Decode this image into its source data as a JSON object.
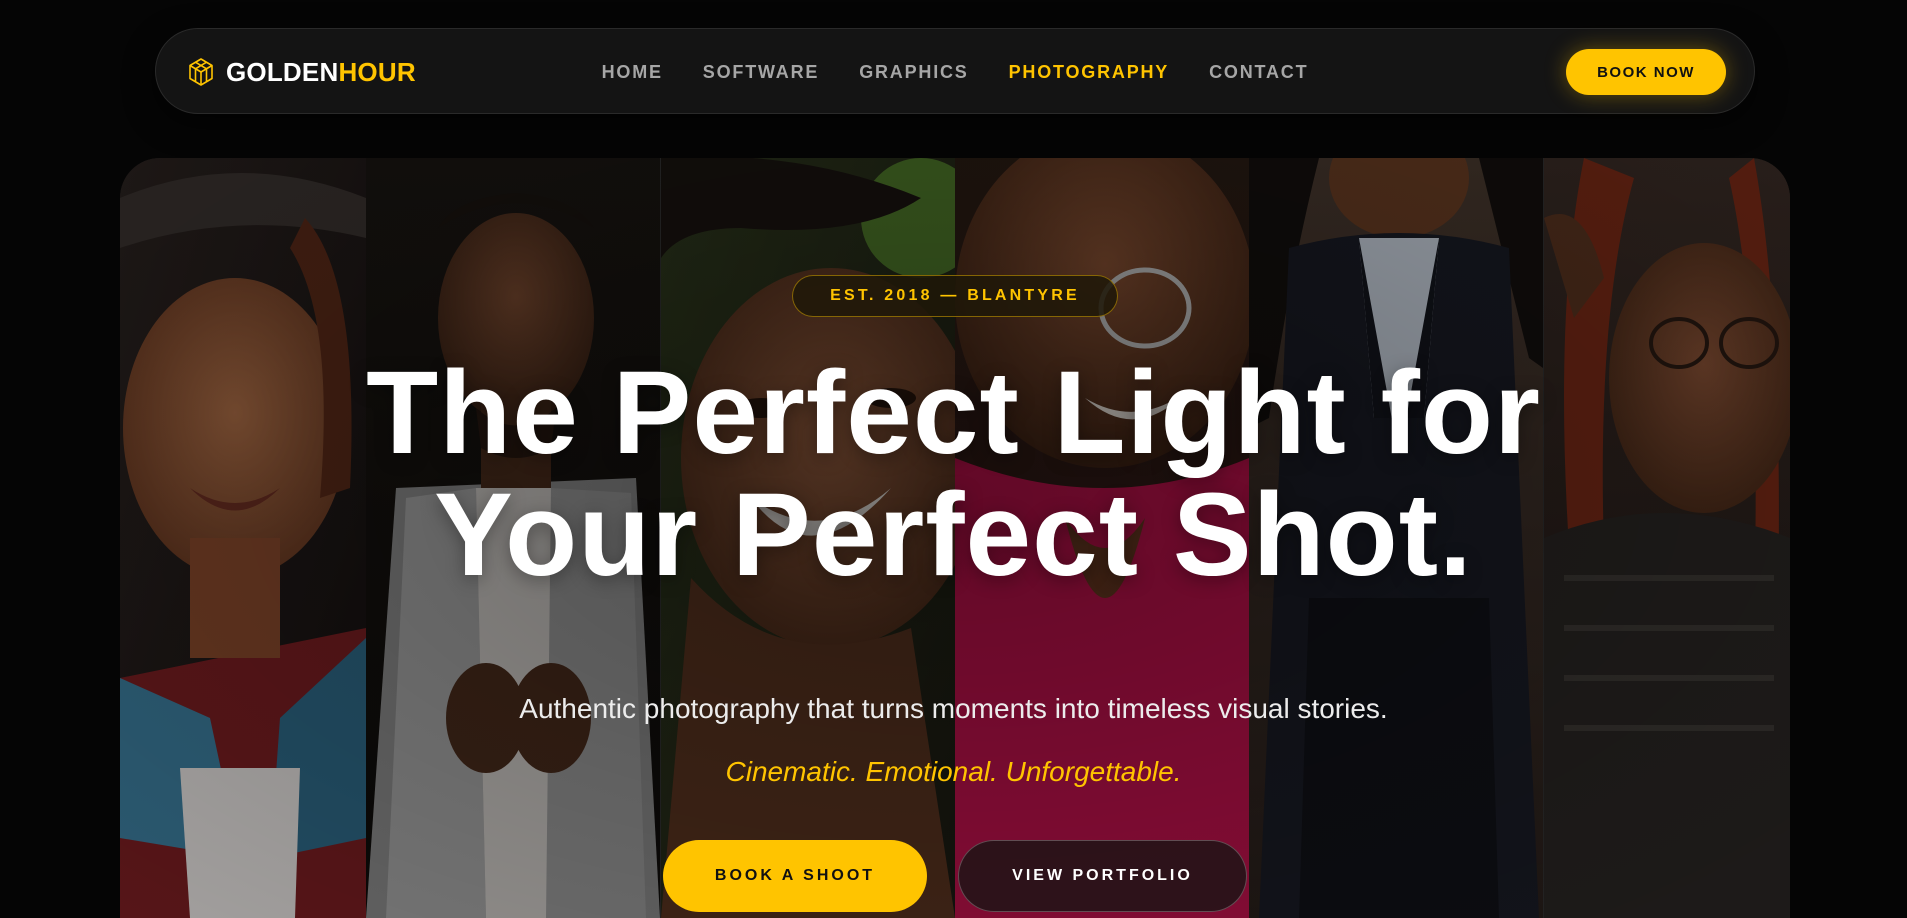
{
  "nav": {
    "brand": {
      "part1": "GOLDEN",
      "part2": "HOUR",
      "logo_icon": "hexagon-cube-icon"
    },
    "links": [
      {
        "label": "HOME",
        "active": false
      },
      {
        "label": "SOFTWARE",
        "active": false
      },
      {
        "label": "GRAPHICS",
        "active": false
      },
      {
        "label": "PHOTOGRAPHY",
        "active": true
      },
      {
        "label": "CONTACT",
        "active": false
      }
    ],
    "cta_label": "BOOK NOW"
  },
  "hero": {
    "badge": "EST. 2018 — BLANTYRE",
    "headline_line1": "The Perfect Light for",
    "headline_line2": "Your Perfect Shot.",
    "subtitle": "Authentic photography that turns moments into timeless visual stories.",
    "tagline": "Cinematic. Emotional. Unforgettable.",
    "primary_cta": "BOOK A SHOOT",
    "secondary_cta": "VIEW PORTFOLIO"
  },
  "colors": {
    "accent": "#ffc400",
    "background": "#050505",
    "nav_background": "#141414",
    "nav_text": "#a6a6a6",
    "text_primary": "#ffffff"
  }
}
